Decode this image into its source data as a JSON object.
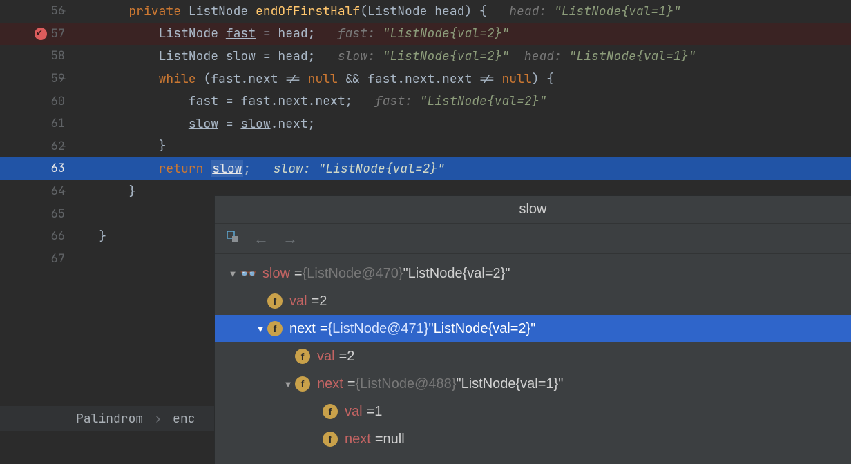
{
  "editor": {
    "lines": [
      {
        "num": "56",
        "fold": "⊟",
        "indent": "        ",
        "tokens": [
          [
            "kw",
            "private "
          ],
          [
            "param-name",
            "ListNode "
          ],
          [
            "fn",
            "endOfFirstHalf"
          ],
          [
            "punct",
            "(ListNode head) {   "
          ]
        ],
        "hint_label": "head:",
        "hint_val": "\"ListNode{val=1}\"",
        "bg": ""
      },
      {
        "num": "57",
        "bp": true,
        "indent": "            ",
        "tokens": [
          [
            "param-name",
            "ListNode "
          ],
          [
            "var-u",
            "fast"
          ],
          [
            "punct",
            " = head;   "
          ]
        ],
        "hint_label": "fast:",
        "hint_val": "\"ListNode{val=2}\"",
        "bg": "bg-bp"
      },
      {
        "num": "58",
        "indent": "            ",
        "tokens": [
          [
            "param-name",
            "ListNode "
          ],
          [
            "var-u",
            "slow"
          ],
          [
            "punct",
            " = head;   "
          ]
        ],
        "hint_label": "slow:",
        "hint_val": "\"ListNode{val=2}\"",
        "extra_hint_label": "  head:",
        "extra_hint_val": "\"ListNode{val=1}\"",
        "bg": ""
      },
      {
        "num": "59",
        "fold": "⊟",
        "indent": "            ",
        "tokens": [
          [
            "kw",
            "while "
          ],
          [
            "punct",
            "("
          ],
          [
            "var-u",
            "fast"
          ],
          [
            "punct",
            ".next != "
          ],
          [
            "kw",
            "null"
          ],
          [
            "punct",
            " && "
          ],
          [
            "var-u",
            "fast"
          ],
          [
            "punct",
            ".next.next != "
          ],
          [
            "kw",
            "null"
          ],
          [
            "punct",
            ") {"
          ]
        ],
        "bg": ""
      },
      {
        "num": "60",
        "indent": "                ",
        "tokens": [
          [
            "var-u",
            "fast"
          ],
          [
            "punct",
            " = "
          ],
          [
            "var-u",
            "fast"
          ],
          [
            "punct",
            ".next.next;   "
          ]
        ],
        "hint_label": "fast:",
        "hint_val": "\"ListNode{val=2}\"",
        "bg": ""
      },
      {
        "num": "61",
        "indent": "                ",
        "tokens": [
          [
            "var-u",
            "slow"
          ],
          [
            "punct",
            " = "
          ],
          [
            "var-u",
            "slow"
          ],
          [
            "punct",
            ".next;"
          ]
        ],
        "bg": ""
      },
      {
        "num": "62",
        "fold": "⊟",
        "indent": "            ",
        "tokens": [
          [
            "punct",
            "}"
          ]
        ],
        "bg": ""
      },
      {
        "num": "63",
        "indent": "            ",
        "tokens": [
          [
            "kw",
            "return "
          ],
          [
            "sel",
            "slow"
          ],
          [
            "punct",
            ";   "
          ]
        ],
        "hint_label": "slow:",
        "hint_val": "\"ListNode{val=2}\"",
        "bg": "bg-exec"
      },
      {
        "num": "64",
        "fold": "⊟",
        "indent": "        ",
        "tokens": [
          [
            "punct",
            "}"
          ]
        ],
        "bg": ""
      },
      {
        "num": "65",
        "indent": "",
        "tokens": [],
        "bg": ""
      },
      {
        "num": "66",
        "indent": "    ",
        "tokens": [
          [
            "punct",
            "}"
          ]
        ],
        "bg": ""
      },
      {
        "num": "67",
        "indent": "",
        "tokens": [],
        "bg": ""
      }
    ]
  },
  "breadcrumb": {
    "a": "Palindrom",
    "sep": "›",
    "b": "enc"
  },
  "popup": {
    "title": "slow",
    "rows": [
      {
        "depth": 0,
        "arrow": "▼",
        "glasses": true,
        "name": "slow",
        "eq": " = ",
        "obj": "{ListNode@470}",
        "str": " \"ListNode{val=2}\"",
        "sel": false
      },
      {
        "depth": 1,
        "arrow": "",
        "badge": "f",
        "name": "val",
        "eq": " = ",
        "str": "2",
        "sel": false
      },
      {
        "depth": 1,
        "arrow": "▼",
        "badge": "f",
        "name": "next",
        "eq": " = ",
        "obj": "{ListNode@471}",
        "str": " \"ListNode{val=2}\"",
        "sel": true
      },
      {
        "depth": 2,
        "arrow": "",
        "badge": "f",
        "name": "val",
        "eq": " = ",
        "str": "2",
        "sel": false
      },
      {
        "depth": 2,
        "arrow": "▼",
        "badge": "f",
        "name": "next",
        "eq": " = ",
        "obj": "{ListNode@488}",
        "str": " \"ListNode{val=1}\"",
        "sel": false
      },
      {
        "depth": 3,
        "arrow": "",
        "badge": "f",
        "name": "val",
        "eq": " = ",
        "str": "1",
        "sel": false
      },
      {
        "depth": 3,
        "arrow": "",
        "badge": "f",
        "name": "next",
        "eq": " = ",
        "str": "null",
        "sel": false
      }
    ]
  }
}
